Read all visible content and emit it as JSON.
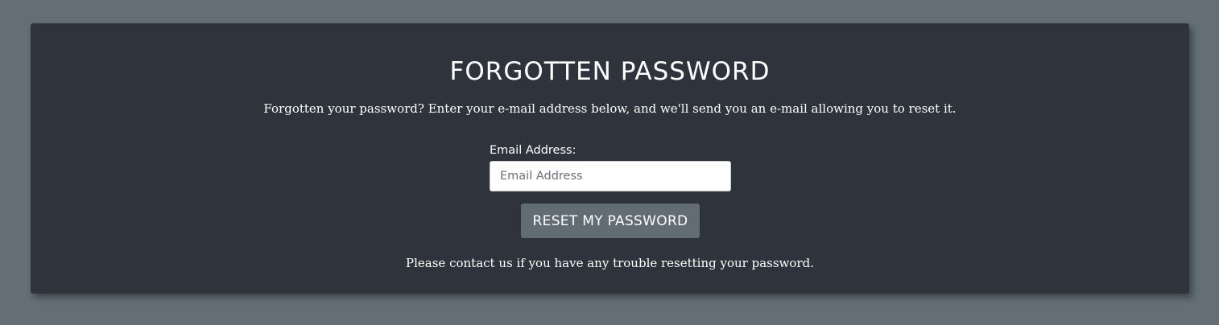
{
  "colors": {
    "page_background": "#636e75",
    "card_background": "#2f333b",
    "button_background": "#626c74",
    "text": "#ffffff",
    "input_background": "#ffffff"
  },
  "form": {
    "title": "FORGOTTEN PASSWORD",
    "intro": "Forgotten your password? Enter your e-mail address below, and we'll send you an e-mail allowing you to reset it.",
    "email_label": "Email Address:",
    "email_placeholder": "Email Address",
    "email_value": "",
    "submit_label": "RESET MY PASSWORD",
    "help_text": "Please contact us if you have any trouble resetting your password."
  }
}
